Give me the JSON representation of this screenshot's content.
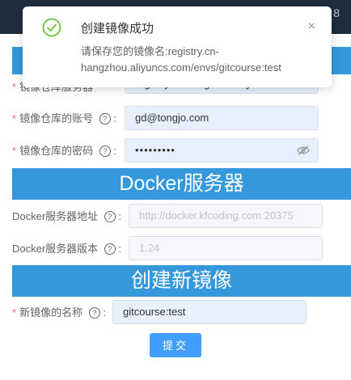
{
  "topbar": {
    "right_text": "8"
  },
  "toast": {
    "title": "创建镜像成功",
    "message": "请保存您的镜像名:registry.cn-hangzhou.aliyuncs.com/envs/gitcourse:test",
    "close_glyph": "×",
    "icon": "check-circle-icon",
    "success_color": "#67c23a"
  },
  "registry": {
    "server_label": "镜像仓库服务器",
    "server_value": "registry.cn-hangzhou.aliyuncs.com",
    "account_label": "镜像仓库的账号",
    "account_value": "gd@tongjo.com",
    "password_label": "镜像仓库的密码",
    "password_value": "•••••••••"
  },
  "docker": {
    "header": "Docker服务器",
    "address_label": "Docker服务器地址",
    "address_placeholder": "http://docker.kfcoding.com:20375",
    "version_label": "Docker服务器版本",
    "version_value": "1.24"
  },
  "create": {
    "header": "创建新镜像",
    "name_label": "新镜像的名称",
    "name_value": "gitcourse:test"
  },
  "submit_label": "提交",
  "help_glyph": "?",
  "required_glyph": "*",
  "colors": {
    "header_bg": "#3498db",
    "primary": "#409eff",
    "required": "#f56c6c"
  }
}
